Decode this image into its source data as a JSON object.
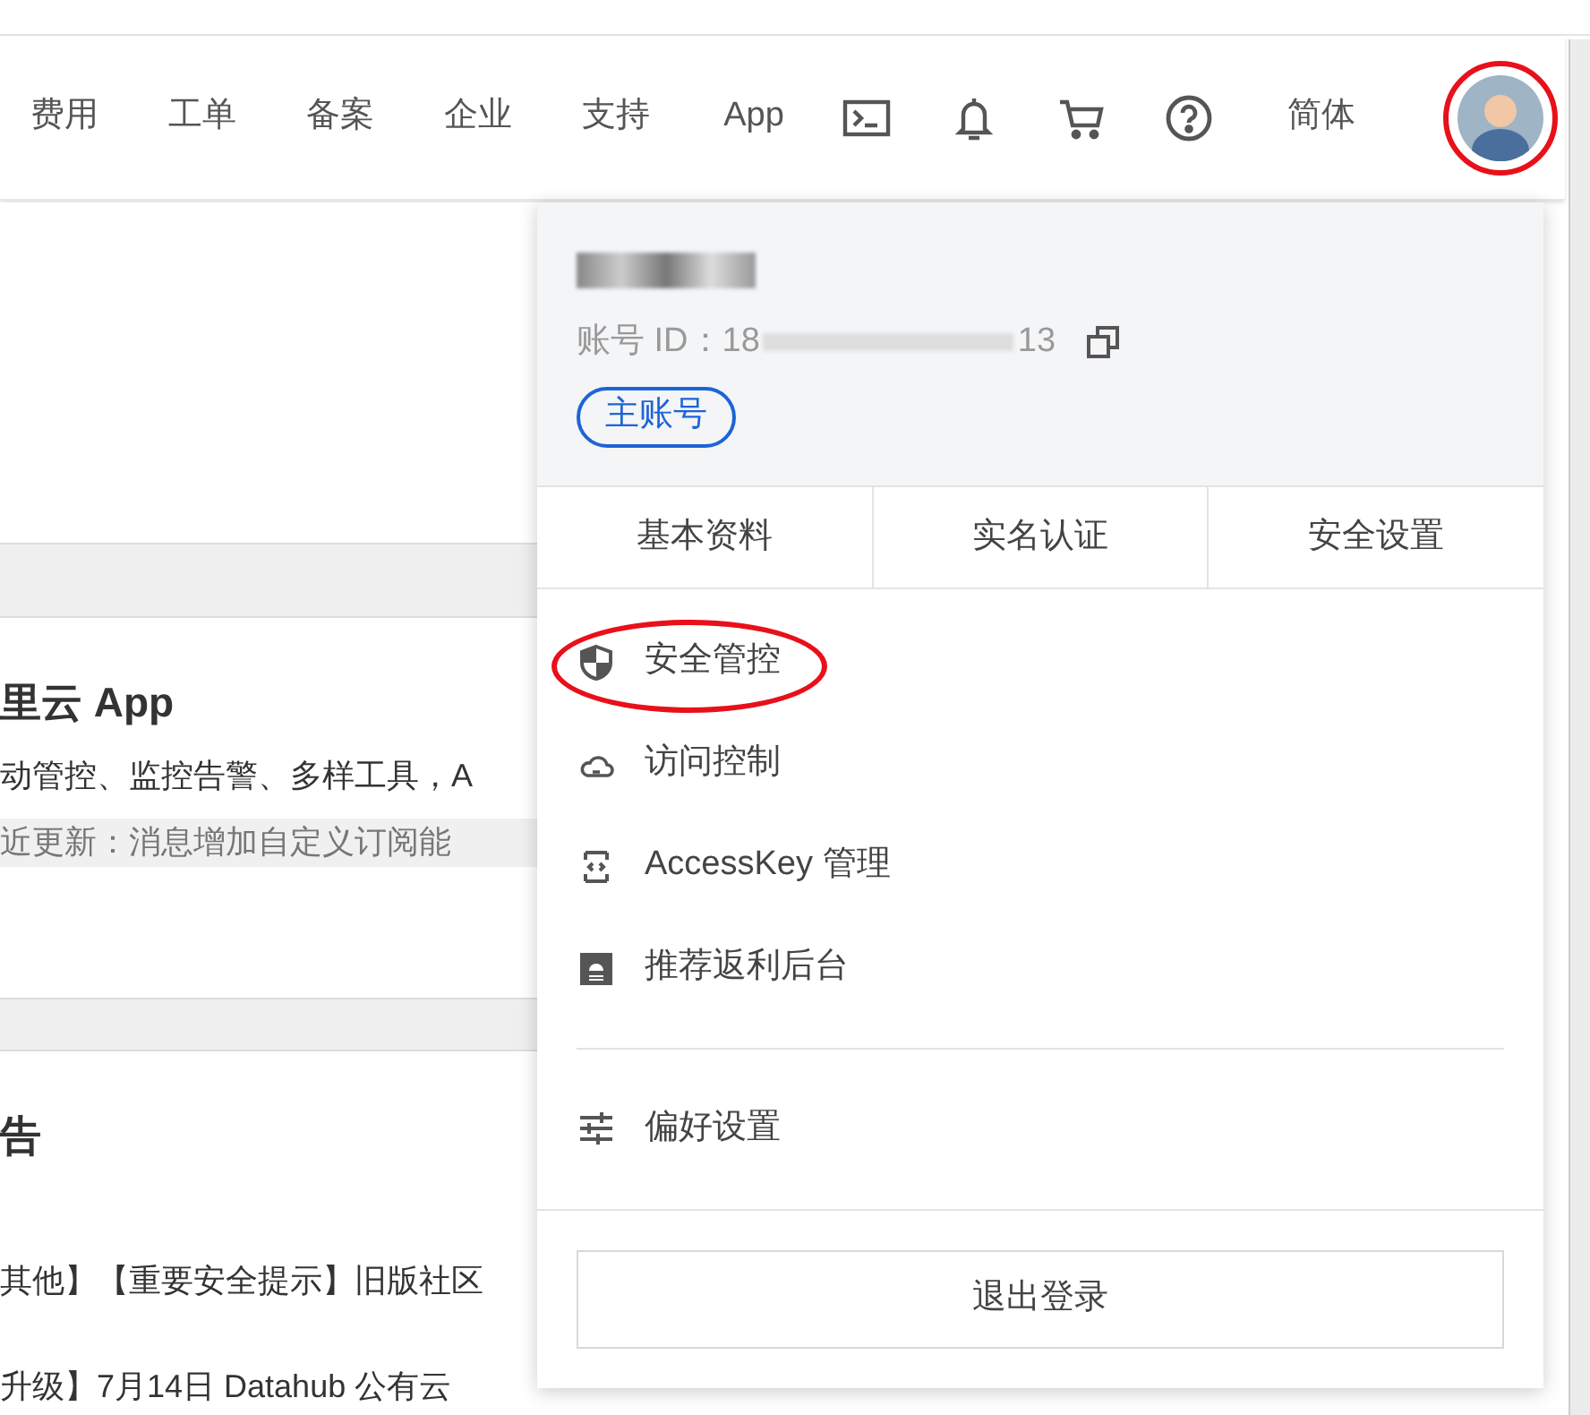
{
  "nav": {
    "items": [
      {
        "label": "费用",
        "kind": "text"
      },
      {
        "label": "工单",
        "kind": "text"
      },
      {
        "label": "备案",
        "kind": "text"
      },
      {
        "label": "企业",
        "kind": "text"
      },
      {
        "label": "支持",
        "kind": "text"
      },
      {
        "label": "App",
        "kind": "text"
      },
      {
        "kind": "terminal"
      },
      {
        "kind": "bell"
      },
      {
        "kind": "cart"
      },
      {
        "kind": "help"
      },
      {
        "label": "简体",
        "kind": "text"
      }
    ],
    "avatar": {
      "highlighted": true
    }
  },
  "background": {
    "app_card": {
      "title": "里云 App",
      "description": "动管控、监控告警、多样工具，A",
      "update": "近更新：消息增加自定义订阅能"
    },
    "notice_card": {
      "title": "告",
      "rows": [
        "其他】【重要安全提示】旧版社区",
        "升级】7月14日 Datahub 公有云"
      ]
    }
  },
  "account_menu": {
    "id_label": "账号 ID：",
    "id_start": "18",
    "id_end": "13",
    "badge": "主账号",
    "tabs": [
      "基本资料",
      "实名认证",
      "安全设置"
    ],
    "items": [
      {
        "label": "安全管控",
        "kind": "shield",
        "highlighted": true
      },
      {
        "label": "访问控制",
        "kind": "cloud",
        "highlighted": false
      },
      {
        "label": "AccessKey 管理",
        "kind": "key",
        "highlighted": false
      },
      {
        "label": "推荐返利后台",
        "kind": "card",
        "highlighted": false
      }
    ],
    "settings": {
      "label": "偏好设置"
    },
    "logout": "退出登录"
  }
}
